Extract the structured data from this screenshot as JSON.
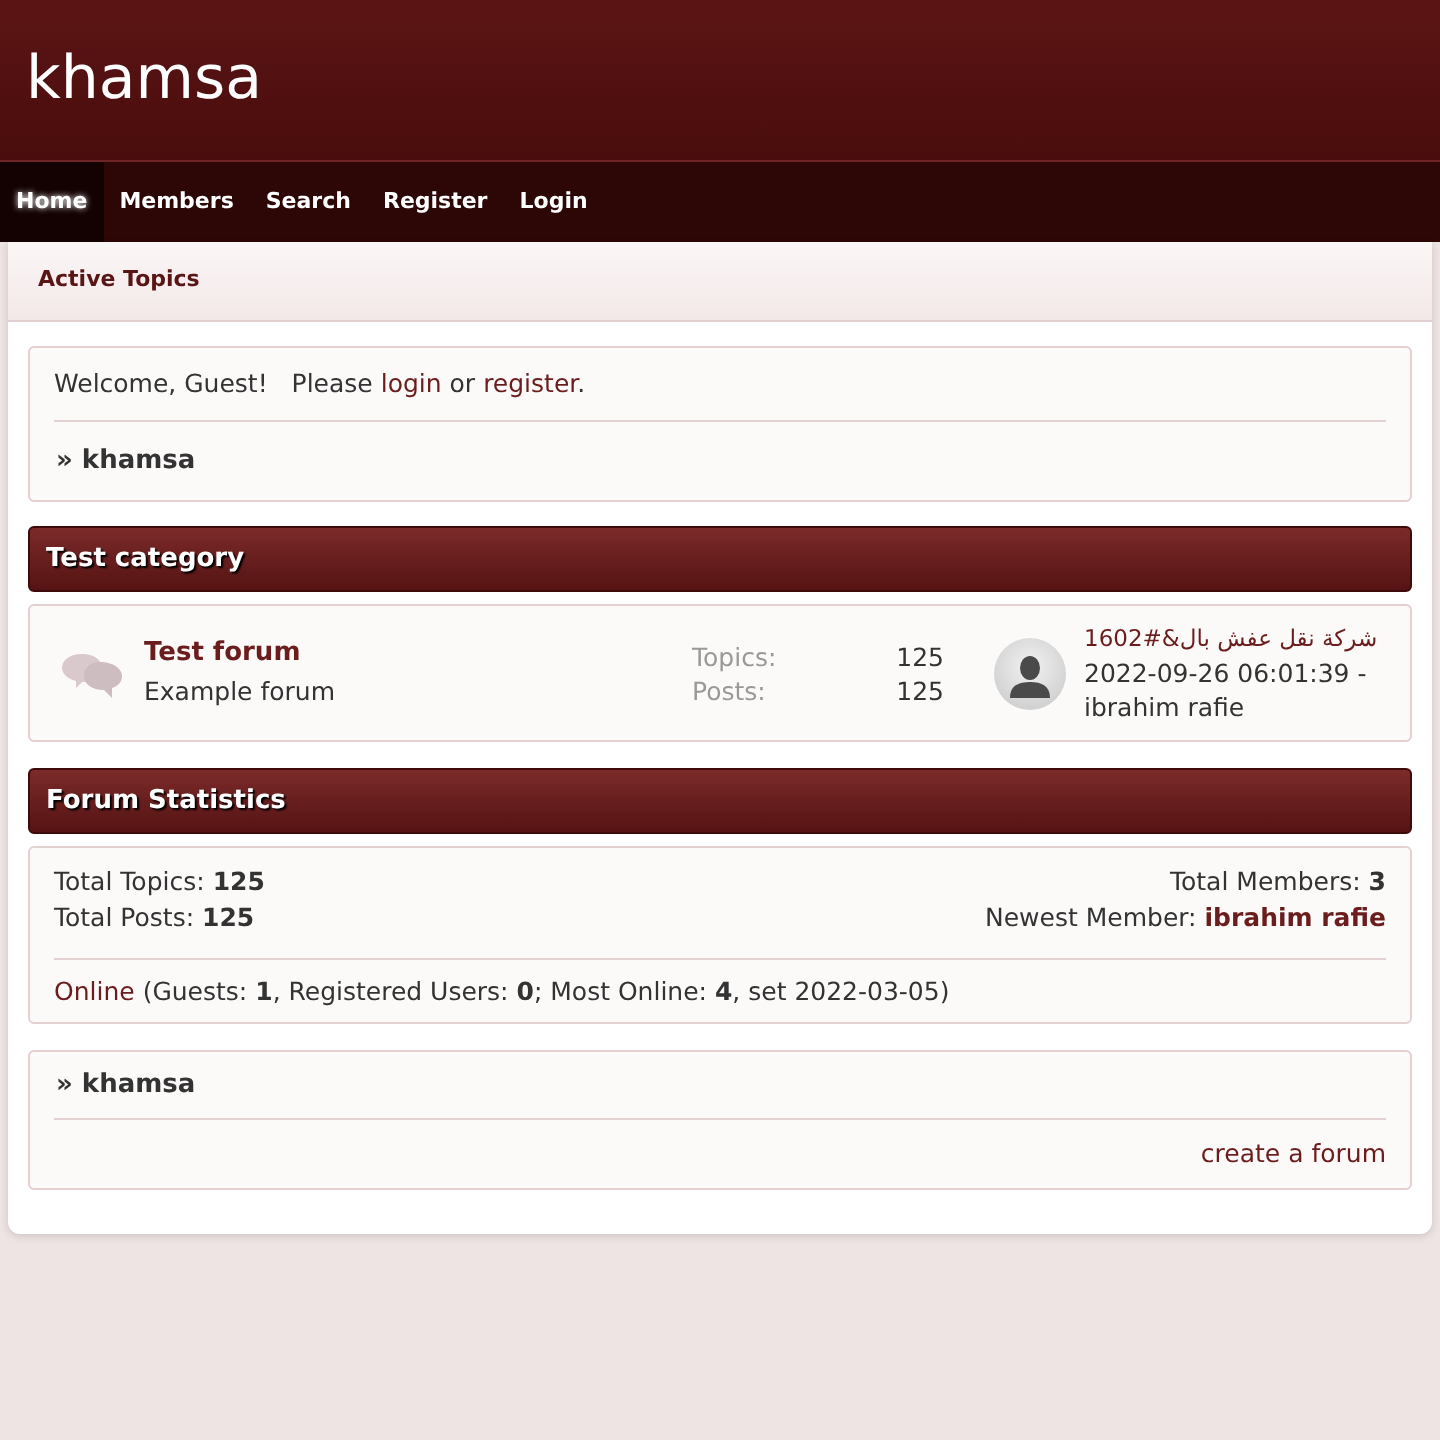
{
  "site": {
    "title": "khamsa"
  },
  "nav": [
    {
      "label": "Home",
      "selected": true
    },
    {
      "label": "Members",
      "selected": false
    },
    {
      "label": "Search",
      "selected": false
    },
    {
      "label": "Register",
      "selected": false
    },
    {
      "label": "Login",
      "selected": false
    }
  ],
  "subnav": {
    "label": "Active Topics"
  },
  "welcome": {
    "greeting": "Welcome, Guest!",
    "prompt": "Please",
    "login": "login",
    "joiner": "or",
    "register": "register",
    "end": ".",
    "breadcrumb": "» khamsa"
  },
  "categories": [
    {
      "title": "Test category",
      "forums": [
        {
          "name": "Test forum",
          "description": "Example forum",
          "stats": [
            {
              "label": "Topics:",
              "value": "125"
            },
            {
              "label": "Posts:",
              "value": "125"
            }
          ],
          "last_post": {
            "title": "شركة نقل عفش بال&#1602",
            "date": "2022-09-26 06:01:39 -",
            "author": "ibrahim rafie"
          }
        }
      ]
    }
  ],
  "statistics": {
    "title": "Forum Statistics",
    "left": [
      {
        "label": "Total Topics:",
        "value": "125",
        "kind": "plain"
      },
      {
        "label": "Total Posts:",
        "value": "125",
        "kind": "plain"
      }
    ],
    "right": [
      {
        "label": "Total Members:",
        "value": "3",
        "kind": "plain"
      },
      {
        "label": "Newest Member:",
        "value": "ibrahim rafie",
        "kind": "link"
      }
    ],
    "online": {
      "link": "Online",
      "text": "(Guests: **1**, Registered Users: **0**; Most Online: **4**, set 2022-03-05)"
    }
  },
  "footer": {
    "breadcrumb": "» khamsa",
    "link": "create a forum"
  }
}
